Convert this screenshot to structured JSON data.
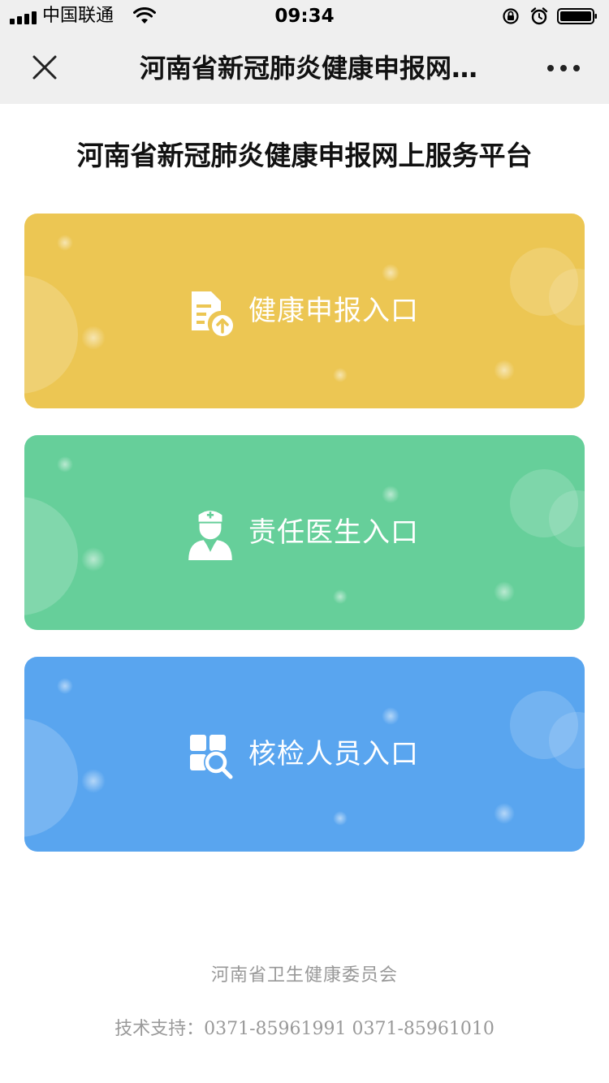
{
  "status_bar": {
    "carrier": "中国联通",
    "time": "09:34"
  },
  "nav": {
    "title": "河南省新冠肺炎健康申报网上服务平台"
  },
  "page": {
    "title": "河南省新冠肺炎健康申报网上服务平台"
  },
  "entries": [
    {
      "label": "健康申报入口",
      "icon": "document-upload-icon",
      "color": "#ecc653"
    },
    {
      "label": "责任医生入口",
      "icon": "doctor-icon",
      "color": "#66cf9a"
    },
    {
      "label": "核检人员入口",
      "icon": "inspection-search-icon",
      "color": "#59a5ef"
    }
  ],
  "footer": {
    "org": "河南省卫生健康委员会",
    "support": "技术支持：0371-85961991  0371-85961010"
  }
}
